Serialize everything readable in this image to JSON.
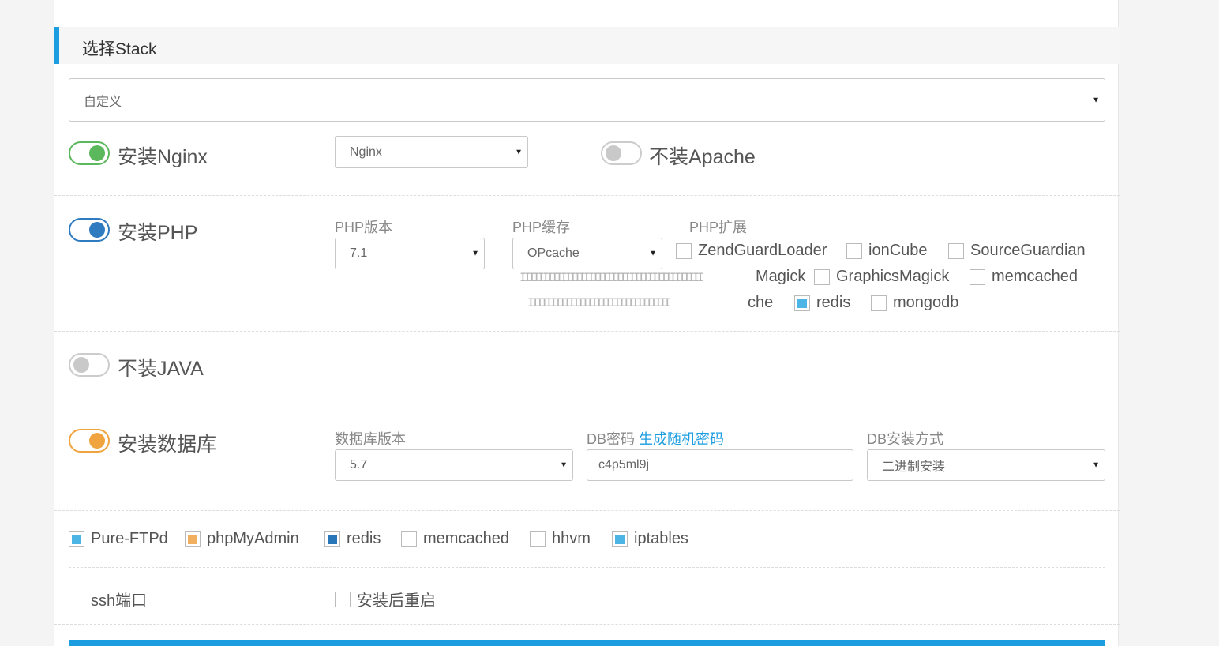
{
  "stack": {
    "title": "选择Stack",
    "preset": "自定义"
  },
  "nginx": {
    "label": "安装Nginx",
    "select": "Nginx",
    "apache_label": "不装Apache"
  },
  "php": {
    "label": "安装PHP",
    "version_label": "PHP版本",
    "version": "7.1",
    "cache_label": "PHP缓存",
    "cache": "OPcache",
    "ext_label": "PHP扩展",
    "extensions": {
      "zend": "ZendGuardLoader",
      "ioncube": "ionCube",
      "sourceguardian": "SourceGuardian",
      "imagick_partial": "Magick",
      "graphicsmagick": "GraphicsMagick",
      "memcached": "memcached",
      "cache_partial": "che",
      "redis": "redis",
      "mongodb": "mongodb"
    }
  },
  "java": {
    "label": "不装JAVA"
  },
  "db": {
    "label": "安装数据库",
    "version_label": "数据库版本",
    "version": "5.7",
    "password_label": "DB密码",
    "generate_link": "生成随机密码",
    "password": "c4p5ml9j",
    "install_label": "DB安装方式",
    "install_method": "二进制安装"
  },
  "extras": {
    "pureftpd": "Pure-FTPd",
    "phpmyadmin": "phpMyAdmin",
    "redis": "redis",
    "memcached": "memcached",
    "hhvm": "hhvm",
    "iptables": "iptables"
  },
  "options": {
    "ssh_port": "ssh端口",
    "reboot": "安装后重启"
  },
  "colors": {
    "accent": "#1c9de0",
    "nginx_switch": "#5cb85c",
    "php_switch": "#2f7bbf",
    "db_switch": "#f0a440"
  }
}
